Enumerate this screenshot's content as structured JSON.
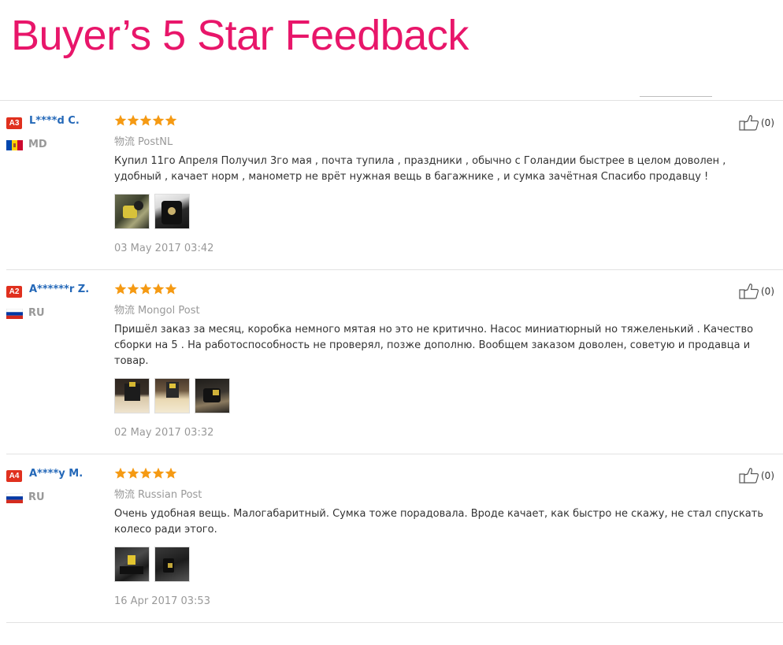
{
  "banner": {
    "title": "Buyer’s 5 Star Feedback"
  },
  "star_color": "#f59a13",
  "reviews": [
    {
      "rank": "A3",
      "username": "L****d C.",
      "country": "MD",
      "flag": "moldova-flag",
      "rating": 5,
      "shipping_label": "物流",
      "carrier": "PostNL",
      "comment": "Купил 11го Апреля Получил 3го мая , почта тупила , праздники , обычно с Голандии быстрее в целом доволен , удобный , качает норм , манометр не врёт нужная вещь в багажнике , и сумка зачётная Спасибо продавцу !",
      "photos": [
        "review-photo-1",
        "review-photo-2"
      ],
      "date": "03 May 2017 03:42",
      "helpful": "(0)"
    },
    {
      "rank": "A2",
      "username": "A******r Z.",
      "country": "RU",
      "flag": "russia-flag",
      "rating": 5,
      "shipping_label": "物流",
      "carrier": "Mongol Post",
      "comment": "Пришёл заказ за месяц, коробка немного мятая но это не критично. Насос миниатюрный но тяжеленький . Качество сборки на 5 . На работоспособность не проверял, позже дополню. Вообщем заказом доволен, советую и продавца и товар.",
      "photos": [
        "review-photo-1",
        "review-photo-2",
        "review-photo-3"
      ],
      "date": "02 May 2017 03:32",
      "helpful": "(0)"
    },
    {
      "rank": "A4",
      "username": "A****y M.",
      "country": "RU",
      "flag": "russia-flag",
      "rating": 5,
      "shipping_label": "物流",
      "carrier": "Russian Post",
      "comment": "Очень удобная вещь. Малогабаритный. Сумка тоже порадовала. Вроде качает, как быстро не скажу, не стал спускать колесо ради этого.",
      "photos": [
        "review-photo-1",
        "review-photo-2"
      ],
      "date": "16 Apr 2017 03:53",
      "helpful": "(0)"
    }
  ]
}
